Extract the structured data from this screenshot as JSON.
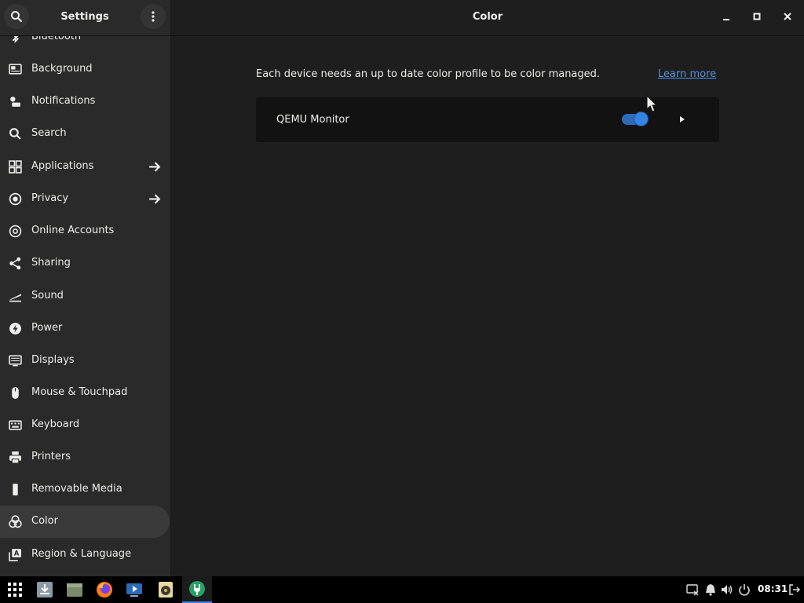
{
  "header": {
    "left_title": "Settings",
    "main_title": "Color",
    "search_icon": "search-icon",
    "menu_icon": "kebab-menu-icon"
  },
  "sidebar": {
    "items": [
      {
        "label": "Bluetooth",
        "icon": "bluetooth-icon",
        "arrow": false,
        "selected": false
      },
      {
        "label": "Background",
        "icon": "background-icon",
        "arrow": false,
        "selected": false
      },
      {
        "label": "Notifications",
        "icon": "notifications-icon",
        "arrow": false,
        "selected": false
      },
      {
        "label": "Search",
        "icon": "search-icon",
        "arrow": false,
        "selected": false
      },
      {
        "label": "Applications",
        "icon": "applications-icon",
        "arrow": true,
        "selected": false
      },
      {
        "label": "Privacy",
        "icon": "privacy-icon",
        "arrow": true,
        "selected": false
      },
      {
        "label": "Online Accounts",
        "icon": "at-sign-icon",
        "arrow": false,
        "selected": false
      },
      {
        "label": "Sharing",
        "icon": "share-icon",
        "arrow": false,
        "selected": false
      },
      {
        "label": "Sound",
        "icon": "sound-icon",
        "arrow": false,
        "selected": false
      },
      {
        "label": "Power",
        "icon": "power-icon",
        "arrow": false,
        "selected": false
      },
      {
        "label": "Displays",
        "icon": "display-icon",
        "arrow": false,
        "selected": false
      },
      {
        "label": "Mouse & Touchpad",
        "icon": "mouse-icon",
        "arrow": false,
        "selected": false
      },
      {
        "label": "Keyboard",
        "icon": "keyboard-icon",
        "arrow": false,
        "selected": false
      },
      {
        "label": "Printers",
        "icon": "printer-icon",
        "arrow": false,
        "selected": false
      },
      {
        "label": "Removable Media",
        "icon": "removable-media-icon",
        "arrow": false,
        "selected": false
      },
      {
        "label": "Color",
        "icon": "color-icon",
        "arrow": false,
        "selected": true
      },
      {
        "label": "Region & Language",
        "icon": "region-language-icon",
        "arrow": false,
        "selected": false
      }
    ]
  },
  "main": {
    "description": "Each device needs an up to date color profile to be color managed.",
    "learn_more": "Learn more",
    "devices": [
      {
        "name": "QEMU Monitor",
        "enabled": true
      }
    ]
  },
  "taskbar": {
    "apps": [
      "app-grid-icon",
      "downloads-icon",
      "files-icon",
      "firefox-icon",
      "screen-recorder-icon",
      "rhythmbox-icon",
      "settings-icon"
    ],
    "active_app": "settings-icon",
    "tray": [
      "display-tray-icon",
      "notification-bell-icon",
      "volume-icon",
      "power-icon",
      "logout-icon"
    ],
    "clock": "08:31"
  },
  "colors": {
    "accent": "#3584e4",
    "link": "#5294e2",
    "sidebar_bg": "#2a2a2a",
    "content_bg": "#1e1e1e",
    "row_bg": "#121212"
  }
}
